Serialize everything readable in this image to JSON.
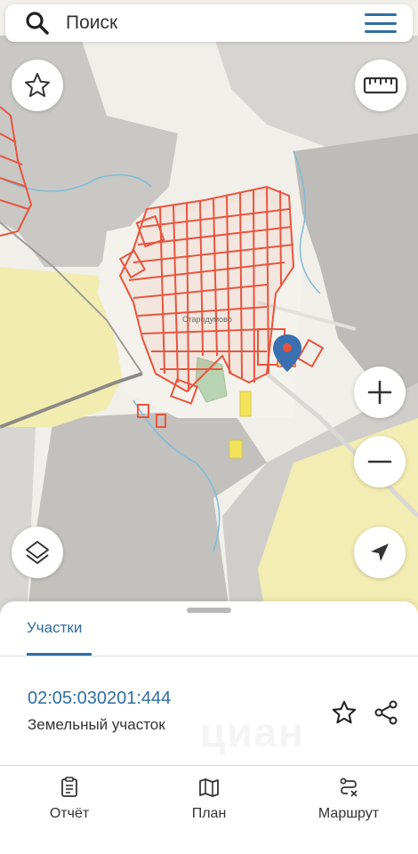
{
  "search": {
    "placeholder": "Поиск"
  },
  "map": {
    "locality_label": "Стародумово"
  },
  "sheet": {
    "tab_label": "Участки",
    "parcel": {
      "cadastral_number": "02:05:030201:444",
      "type": "Земельный участок"
    },
    "watermark": "циан"
  },
  "bottom_nav": [
    {
      "label": "Отчёт",
      "icon": "report-icon"
    },
    {
      "label": "План",
      "icon": "map-icon"
    },
    {
      "label": "Маршрут",
      "icon": "route-icon"
    }
  ],
  "colors": {
    "accent": "#2f6ea3",
    "parcel_outline": "#e8553f",
    "selected_parcel": "#f3e35b",
    "marker": "#3a6fb0"
  }
}
